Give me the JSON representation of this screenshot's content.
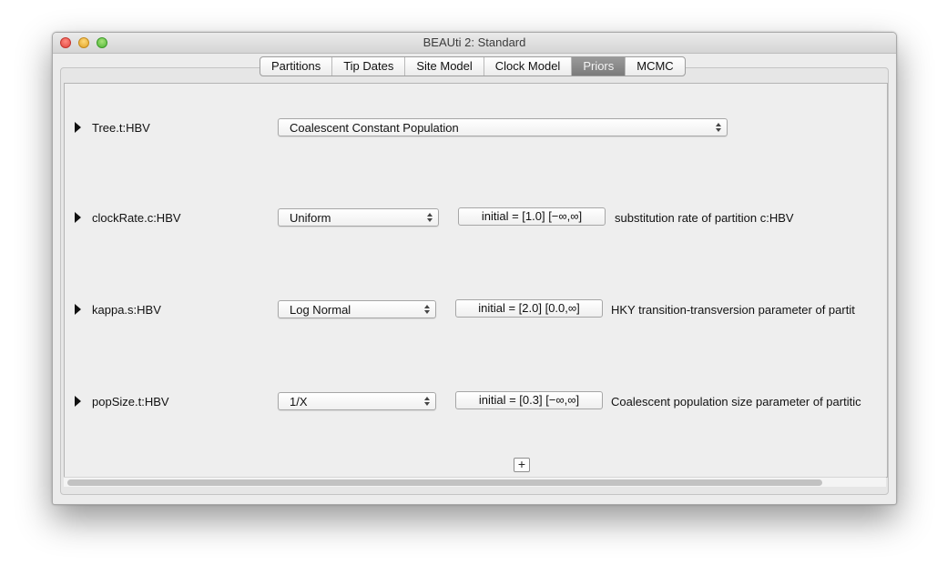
{
  "window": {
    "title": "BEAUti 2: Standard"
  },
  "tabs": [
    {
      "label": "Partitions",
      "active": false
    },
    {
      "label": "Tip Dates",
      "active": false
    },
    {
      "label": "Site Model",
      "active": false
    },
    {
      "label": "Clock Model",
      "active": false
    },
    {
      "label": "Priors",
      "active": true
    },
    {
      "label": "MCMC",
      "active": false
    }
  ],
  "priors": [
    {
      "name": "Tree.t:HBV",
      "distribution": "Coalescent Constant Population"
    },
    {
      "name": "clockRate.c:HBV",
      "distribution": "Uniform",
      "initial": "initial = [1.0] [−∞,∞]",
      "description": "substitution rate of partition c:HBV"
    },
    {
      "name": "kappa.s:HBV",
      "distribution": "Log Normal",
      "initial": "initial = [2.0] [0.0,∞]",
      "description": "HKY transition-transversion parameter of partit"
    },
    {
      "name": "popSize.t:HBV",
      "distribution": "1/X",
      "initial": "initial = [0.3] [−∞,∞]",
      "description": "Coalescent population size parameter of partitic"
    }
  ],
  "add_button": {
    "label": "+"
  },
  "icons": {
    "expand": "disclosure-triangle-icon",
    "popup": "updown-arrows-icon"
  }
}
